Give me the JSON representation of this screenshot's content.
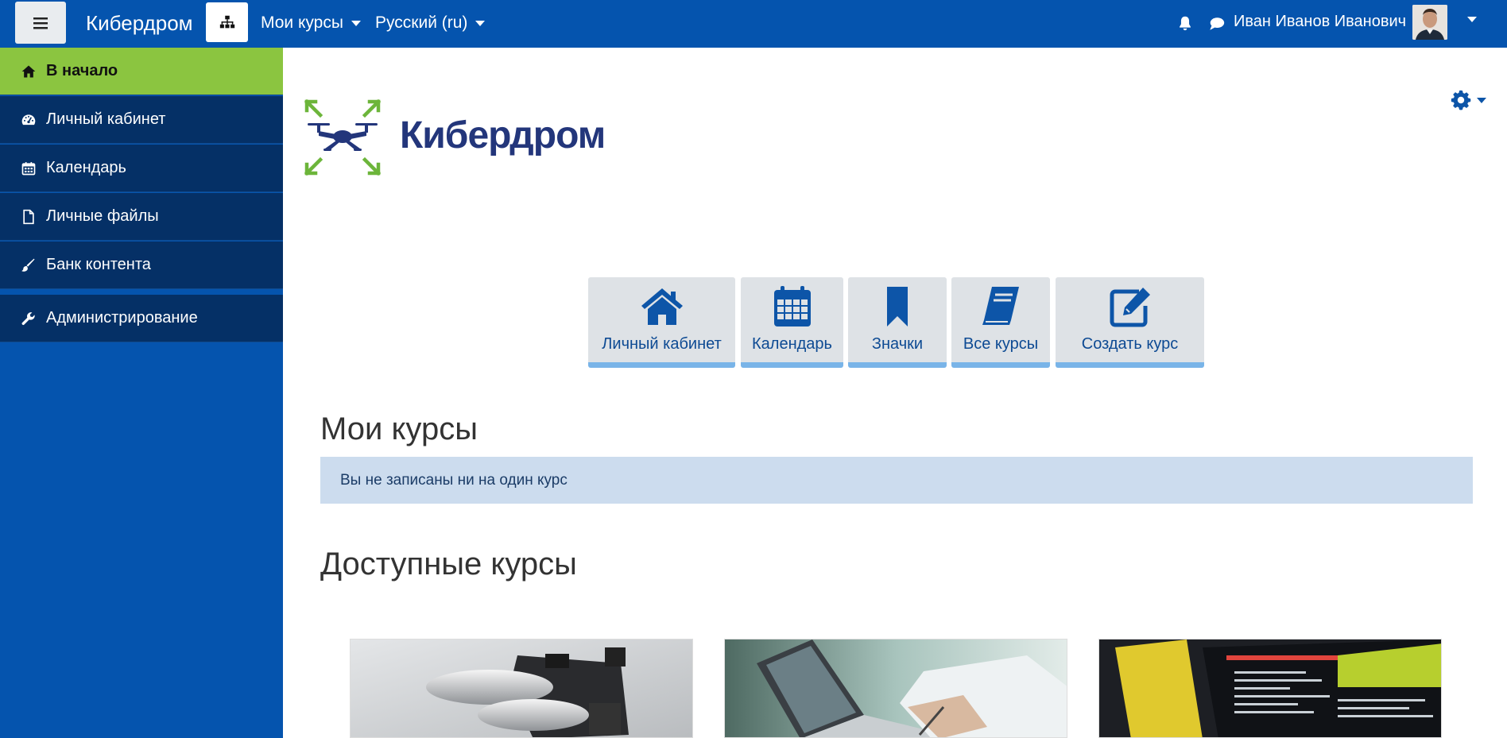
{
  "navbar": {
    "brand": "Кибердром",
    "my_courses": "Мои курсы",
    "language": "Русский (ru)",
    "user_name": "Иван Иванов Иванович"
  },
  "sidebar": {
    "items": [
      {
        "label": "В начало",
        "icon": "home-icon",
        "active": true
      },
      {
        "label": "Личный кабинет",
        "icon": "dashboard-icon"
      },
      {
        "label": "Календарь",
        "icon": "calendar-icon"
      },
      {
        "label": "Личные файлы",
        "icon": "file-icon"
      },
      {
        "label": "Банк контента",
        "icon": "brush-icon"
      },
      {
        "label": "Администрирование",
        "icon": "wrench-icon"
      }
    ]
  },
  "logo": {
    "text": "Кибердром"
  },
  "tiles": [
    {
      "label": "Личный кабинет",
      "icon": "home-icon"
    },
    {
      "label": "Календарь",
      "icon": "calendar-icon"
    },
    {
      "label": "Значки",
      "icon": "bookmark-icon"
    },
    {
      "label": "Все курсы",
      "icon": "book-icon"
    },
    {
      "label": "Создать курс",
      "icon": "edit-icon"
    }
  ],
  "my_courses": {
    "heading": "Мои курсы",
    "empty_message": "Вы не записаны ни на один курс"
  },
  "available_courses": {
    "heading": "Доступные курсы"
  },
  "colors": {
    "navbar": "#0554ae",
    "sidebar_item": "#053066",
    "active": "#8bc540",
    "tile": "#dee2e6",
    "accent": "#0d4a93"
  }
}
